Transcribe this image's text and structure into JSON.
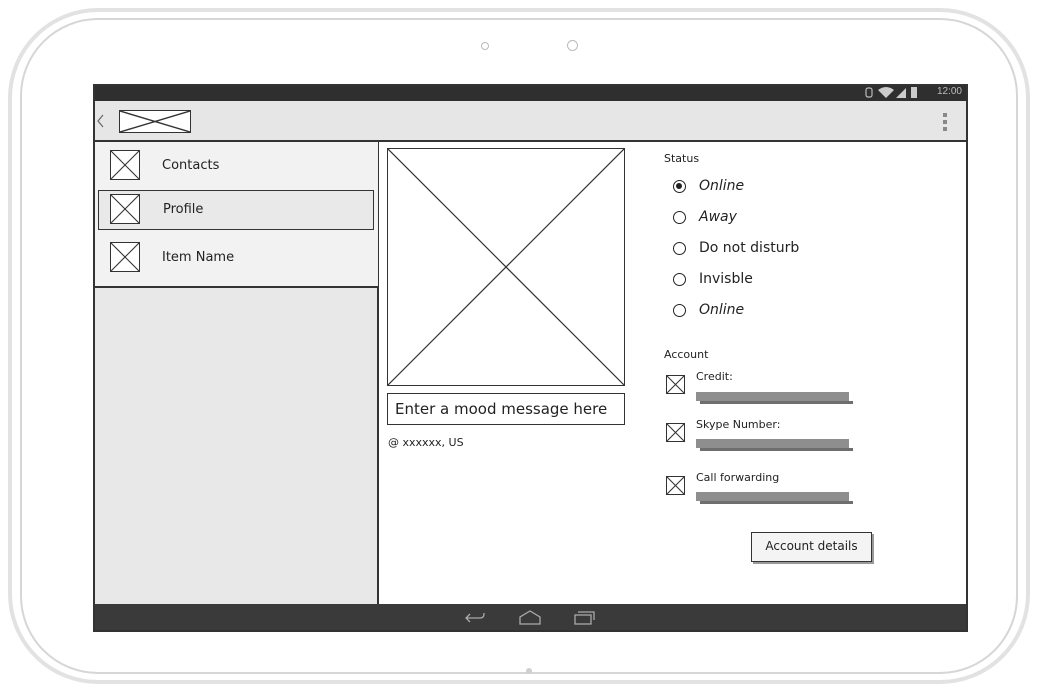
{
  "status_bar": {
    "time": "12:00"
  },
  "sidebar": {
    "items": [
      {
        "label": "Contacts",
        "selected": false
      },
      {
        "label": "Profile",
        "selected": true
      },
      {
        "label": "Item Name",
        "selected": false
      }
    ]
  },
  "profile": {
    "mood_placeholder": "Enter a mood message here",
    "location": "@ xxxxxx, US"
  },
  "status": {
    "heading": "Status",
    "options": [
      {
        "label": "Online",
        "selected": true,
        "italic": true
      },
      {
        "label": "Away",
        "selected": false,
        "italic": true
      },
      {
        "label": "Do not disturb",
        "selected": false,
        "italic": false
      },
      {
        "label": "Invisble",
        "selected": false,
        "italic": false
      },
      {
        "label": "Online",
        "selected": false,
        "italic": true
      }
    ]
  },
  "account": {
    "heading": "Account",
    "items": [
      {
        "label": "Credit:"
      },
      {
        "label": "Skype Number:"
      },
      {
        "label": "Call forwarding"
      }
    ],
    "details_button": "Account details"
  },
  "colors": {
    "statusbar_bg": "#2f2f2f",
    "actionbar_bg": "#e6e6e6",
    "sidebar_bg": "#e8e8e8",
    "navbar_bg": "#3a3a3a",
    "placeholder_bar": "#8e8e8e"
  }
}
